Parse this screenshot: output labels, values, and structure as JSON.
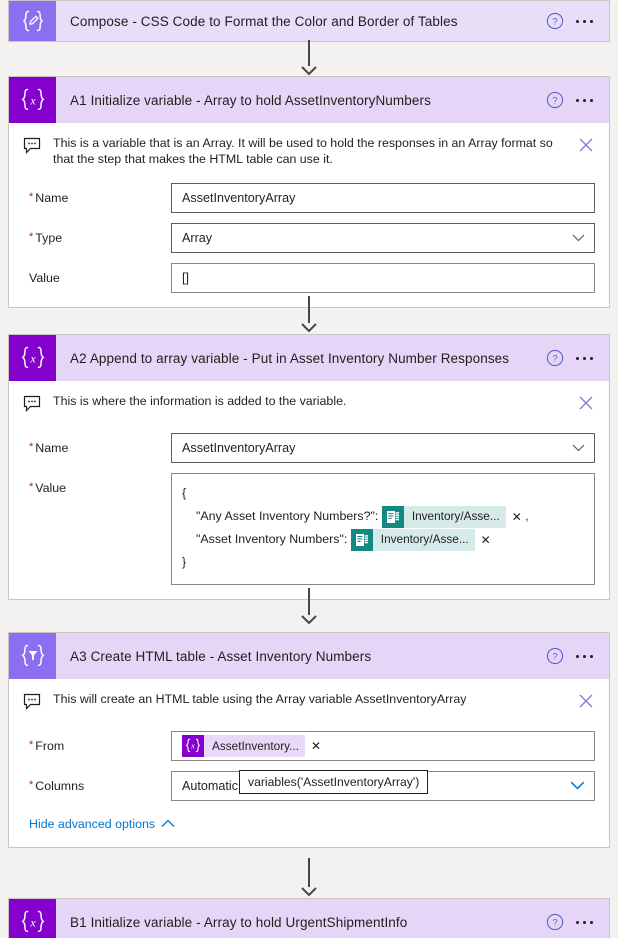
{
  "theme": {
    "canvas_bg": "#f3f2f1",
    "card_bg": "#ffffff",
    "card_border": "#c8c6c4",
    "header_bg": "#e5d6f7",
    "variables_tile": "#8400cc",
    "compose_tile": "#8c6ff0",
    "dataops_tile": "#8c6ff0",
    "required_star": "#a4262c",
    "link_blue": "#0078d4",
    "forms_token": "#128a82",
    "forms_token_bg": "#d6ebe9",
    "variable_token_bg": "#e9d8f8",
    "connector": "#484644"
  },
  "steps": [
    {
      "id": "compose",
      "title": "Compose - CSS Code to Format the Color and Border of Tables",
      "icon": "compose-braces-pencil-icon",
      "icon_kind": "compose",
      "collapsed": true,
      "help_icon": "help-circle-icon",
      "more_icon": "more-options-icon"
    },
    {
      "id": "a1",
      "title": "A1 Initialize variable - Array to hold AssetInventoryNumbers",
      "icon": "variables-braces-x-icon",
      "icon_kind": "variables",
      "collapsed": false,
      "help_icon": "help-circle-icon",
      "more_icon": "more-options-icon",
      "comment": {
        "icon": "comment-bubble-icon",
        "text": "This is a variable that is an Array. It will be used to hold the responses in an Array format so that the step that makes the HTML table can use it.",
        "close_icon": "close-icon"
      },
      "fields": [
        {
          "label": "Name",
          "required": true,
          "kind": "text",
          "value": "AssetInventoryArray"
        },
        {
          "label": "Type",
          "required": true,
          "kind": "dropdown",
          "value": "Array"
        },
        {
          "label": "Value",
          "required": false,
          "kind": "text",
          "value": "[]"
        }
      ]
    },
    {
      "id": "a2",
      "title": "A2 Append to array variable - Put in Asset Inventory Number Responses",
      "icon": "variables-braces-x-icon",
      "icon_kind": "variables",
      "collapsed": false,
      "help_icon": "help-circle-icon",
      "more_icon": "more-options-icon",
      "comment": {
        "icon": "comment-bubble-icon",
        "text": "This is where the information is added to the variable.",
        "close_icon": "close-icon"
      },
      "fields": [
        {
          "label": "Name",
          "required": true,
          "kind": "dropdown",
          "value": "AssetInventoryArray"
        }
      ],
      "value_field": {
        "label": "Value",
        "required": true,
        "lines": {
          "open_brace": "{",
          "key1": "\"Any Asset Inventory Numbers?\":",
          "key2": "\"Asset Inventory Numbers\":",
          "close_brace": "}",
          "comma": ","
        },
        "tokens": [
          {
            "icon": "microsoft-forms-icon",
            "label": "Inventory/Asse...",
            "remove_icon": "remove-token-icon"
          },
          {
            "icon": "microsoft-forms-icon",
            "label": "Inventory/Asse...",
            "remove_icon": "remove-token-icon"
          }
        ]
      }
    },
    {
      "id": "a3",
      "title": "A3 Create HTML table - Asset Inventory Numbers",
      "icon": "data-operations-funnel-icon",
      "icon_kind": "dataops",
      "collapsed": false,
      "help_icon": "help-circle-icon",
      "more_icon": "more-options-icon",
      "comment": {
        "icon": "comment-bubble-icon",
        "text": "This will create an HTML table using the Array variable AssetInventoryArray",
        "close_icon": "close-icon"
      },
      "from_field": {
        "label": "From",
        "required": true,
        "token": {
          "icon": "variables-braces-x-icon",
          "label": "AssetInventory...",
          "remove_icon": "remove-token-icon"
        }
      },
      "columns_field": {
        "label": "Columns",
        "required": true,
        "value": "Automatic",
        "chevron_icon": "chevron-down-icon"
      },
      "tooltip": "variables('AssetInventoryArray')",
      "advanced": {
        "label": "Hide advanced options",
        "icon": "chevron-up-icon"
      }
    },
    {
      "id": "b1",
      "title": "B1 Initialize variable - Array to hold UrgentShipmentInfo",
      "icon": "variables-braces-x-icon",
      "icon_kind": "variables",
      "collapsed": true,
      "help_icon": "help-circle-icon",
      "more_icon": "more-options-icon"
    }
  ],
  "connectors": [
    {
      "name": "connector-compose-to-a1"
    },
    {
      "name": "connector-a1-to-a2"
    },
    {
      "name": "connector-a2-to-a3"
    },
    {
      "name": "connector-a3-to-b1"
    }
  ]
}
